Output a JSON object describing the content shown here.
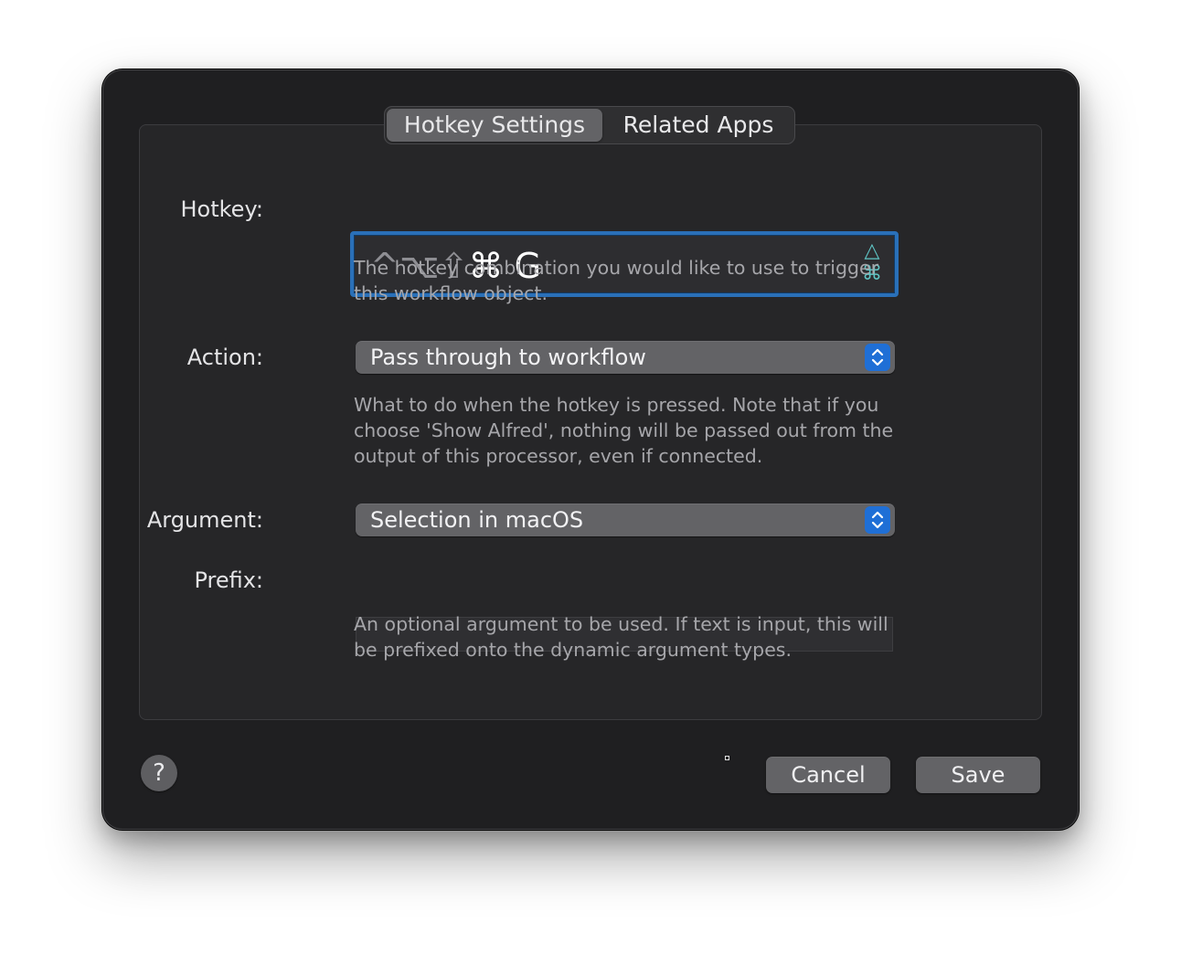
{
  "tabs": [
    {
      "label": "Hotkey Settings",
      "selected": true
    },
    {
      "label": "Related Apps",
      "selected": false
    }
  ],
  "hotkey": {
    "label": "Hotkey:",
    "dim_modifiers": "^⌥⇧",
    "active_modifiers": "⌘",
    "key": "G",
    "toggle_icons": [
      "△",
      "⌘"
    ],
    "help": "The hotkey combination you would like to use to trigger this workflow object."
  },
  "action": {
    "label": "Action:",
    "value": "Pass through to workflow",
    "help": "What to do when the hotkey is pressed. Note that if you choose 'Show Alfred', nothing will be passed out from the output of this processor, even if connected."
  },
  "argument": {
    "label": "Argument:",
    "value": "Selection in macOS"
  },
  "prefix": {
    "label": "Prefix:",
    "value": "",
    "help": "An optional argument to be used. If text is input, this will be prefixed onto the dynamic argument types."
  },
  "footer": {
    "help_label": "?",
    "cancel_label": "Cancel",
    "save_label": "Save"
  },
  "colors": {
    "accent": "#2a70b8",
    "stepper": "#1f6fd6",
    "toggle": "#5fc6c6"
  }
}
